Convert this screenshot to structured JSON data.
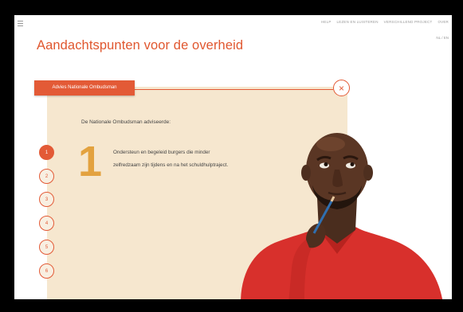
{
  "topnav": {
    "items": [
      "HELP",
      "LEZEN EN LUISTEREN",
      "VERSCHILLEND PROJECT",
      "OVER"
    ]
  },
  "lang_label": "NL / EN",
  "page_title": "Aandachtspunten voor de overheid",
  "tab_label": "Advies Nationale Ombudsman",
  "close_icon": "×",
  "intro": "De Nationale Ombudsman adviseerde:",
  "recommendation": {
    "number": "1",
    "text": "Ondersteun en begeleid burgers die minder zelfredzaam zijn tijdens en na het schuldhulptraject."
  },
  "steps": [
    "1",
    "2",
    "3",
    "4",
    "5",
    "6"
  ],
  "active_step": "1",
  "colors": {
    "accent": "#e35a36",
    "panel": "#f6e7cf",
    "number": "#e3a23f",
    "shirt": "#d8302c"
  }
}
